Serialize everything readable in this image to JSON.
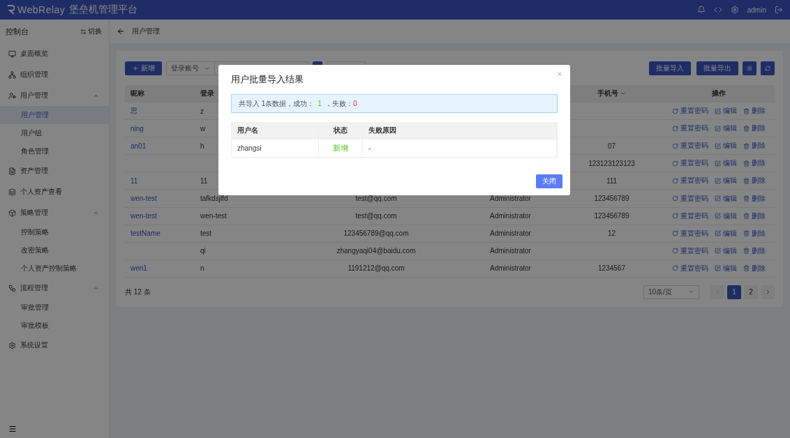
{
  "header": {
    "brand": "WebRelay",
    "title": "堡垒机管理平台",
    "user": "admin"
  },
  "sidebar": {
    "title": "控制台",
    "switch_label": "切换",
    "items": [
      {
        "label": "桌面概览",
        "selected": false
      },
      {
        "label": "组织管理",
        "selected": false
      },
      {
        "label": "用户管理",
        "selected": false,
        "expanded": true,
        "children": [
          {
            "label": "用户管理",
            "selected": true
          },
          {
            "label": "用户组",
            "selected": false
          },
          {
            "label": "角色管理",
            "selected": false
          }
        ]
      },
      {
        "label": "资产管理",
        "selected": false
      },
      {
        "label": "个人资产查看",
        "selected": false
      },
      {
        "label": "策略管理",
        "selected": false,
        "expanded": true,
        "children": [
          {
            "label": "控制策略",
            "selected": false
          },
          {
            "label": "改密策略",
            "selected": false
          },
          {
            "label": "个人资产控制策略",
            "selected": false
          }
        ]
      },
      {
        "label": "流程管理",
        "selected": false,
        "expanded": true,
        "children": [
          {
            "label": "审批管理",
            "selected": false
          },
          {
            "label": "审批模板",
            "selected": false
          }
        ]
      },
      {
        "label": "系统设置",
        "selected": false
      }
    ]
  },
  "breadcrumb": {
    "title": "用户管理"
  },
  "toolbar": {
    "add_label": "新增",
    "filter_select": "登录账号",
    "import_label": "批量导入",
    "export_label": "批量导出"
  },
  "table": {
    "columns": [
      {
        "label": "昵称"
      },
      {
        "label": "登录"
      },
      {
        "label": "手机号",
        "sortable": true
      },
      {
        "label": "操作"
      }
    ],
    "rows": [
      {
        "nickname": "思",
        "login": "z",
        "actions": [
          "重置密码",
          "编辑",
          "删除"
        ]
      },
      {
        "nickname": "ning",
        "login": "w",
        "actions": [
          "重置密码",
          "编辑",
          "删除"
        ]
      },
      {
        "nickname": "an01",
        "login": "h",
        "phone": "07",
        "actions": [
          "重置密码",
          "编辑",
          "删除"
        ]
      },
      {
        "phone": "123123123123",
        "actions": [
          "重置密码",
          "编辑",
          "删除"
        ]
      },
      {
        "nickname": "11",
        "login": "11",
        "phone": "111",
        "actions": [
          "重置密码",
          "编辑",
          "删除"
        ]
      },
      {
        "nickname": "wen-test",
        "login": "tafkdsjlfd",
        "email": "test@qq.com",
        "role": "Administrator",
        "phone": "123456789",
        "actions": [
          "重置密码",
          "编辑",
          "删除"
        ]
      },
      {
        "nickname": "wen-test",
        "login": "wen-test",
        "email": "test@qq.com",
        "role": "Administrator",
        "phone": "123456789",
        "actions": [
          "重置密码",
          "编辑",
          "删除"
        ]
      },
      {
        "nickname": "testName",
        "login": "test",
        "email": "123456789@qq.com",
        "role": "Administrator",
        "phone": "12",
        "actions": [
          "重置密码",
          "编辑",
          "删除"
        ]
      },
      {
        "login": "qi",
        "email": "zhangyaqi04@baidu.com",
        "role": "Administrator",
        "actions": [
          "重置密码",
          "编辑",
          "删除"
        ]
      },
      {
        "nickname": "wen1",
        "login": "n",
        "email": "1191212@qq.com",
        "role": "Administrator",
        "phone": "1234567",
        "actions": [
          "重置密码",
          "编辑",
          "删除"
        ]
      }
    ]
  },
  "pagination": {
    "total": "共 12 条",
    "page_size": "10条/页",
    "pages": [
      {
        "label": "1",
        "selected": true
      },
      {
        "label": "2",
        "selected": false
      }
    ],
    "prev_disabled": true
  },
  "dialog": {
    "title": "用户批量导入结果",
    "summary": {
      "text": "共导入 1条数据，成功：",
      "success": "1",
      "separator": "，失败：",
      "failed": "0"
    },
    "columns": [
      "用户名",
      "状态",
      "失败原因"
    ],
    "rows": [
      {
        "username": "zhangsi",
        "status": "新增",
        "kind": "added",
        "reason": "-"
      }
    ],
    "close_label": "关闭"
  }
}
